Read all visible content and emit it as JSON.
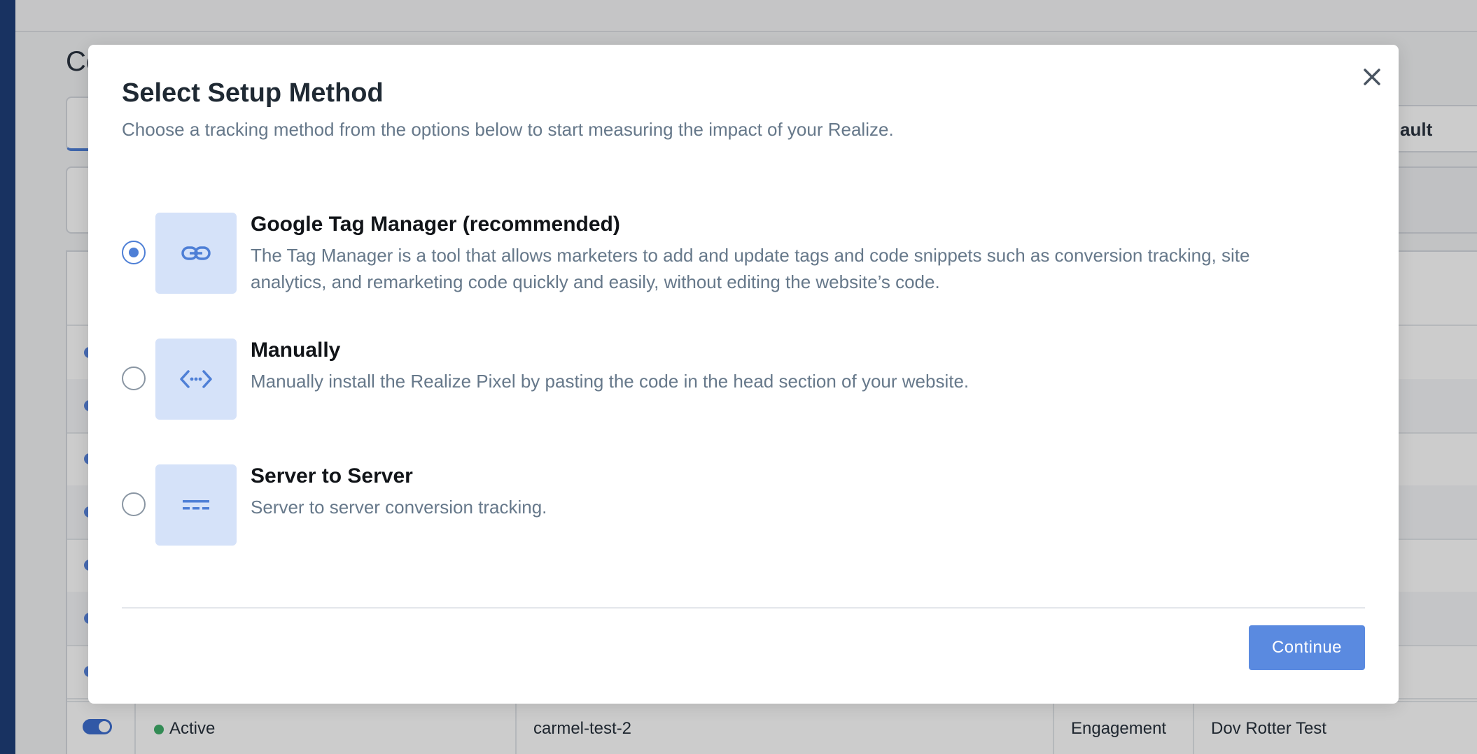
{
  "background": {
    "page_title": "Co",
    "column_header_partial": "ault",
    "visible_row": {
      "status": "Active",
      "name": "carmel-test-2",
      "category": "Engagement",
      "account": "Dov Rotter Test"
    }
  },
  "modal": {
    "title": "Select Setup Method",
    "subtitle": "Choose a tracking method from the options below to start measuring the impact of your Realize.",
    "options": [
      {
        "title": "Google Tag Manager (recommended)",
        "description": "The Tag Manager is a tool that allows marketers to add and update tags and code snippets such as conversion tracking, site analytics, and remarketing code quickly and easily, without editing the website’s code.",
        "icon": "link-icon",
        "selected": true
      },
      {
        "title": "Manually",
        "description": "Manually install the Realize Pixel by pasting the code in the head section of your website.",
        "icon": "code-icon",
        "selected": false
      },
      {
        "title": "Server to Server",
        "description": "Server to server conversion tracking.",
        "icon": "server-icon",
        "selected": false
      }
    ],
    "continue_label": "Continue",
    "close_icon": "close-icon"
  },
  "colors": {
    "accent": "#5a8ae0",
    "icon_bg": "#d5e2f9",
    "status_active": "#3fae6a",
    "nav": "#1f3f7a"
  }
}
